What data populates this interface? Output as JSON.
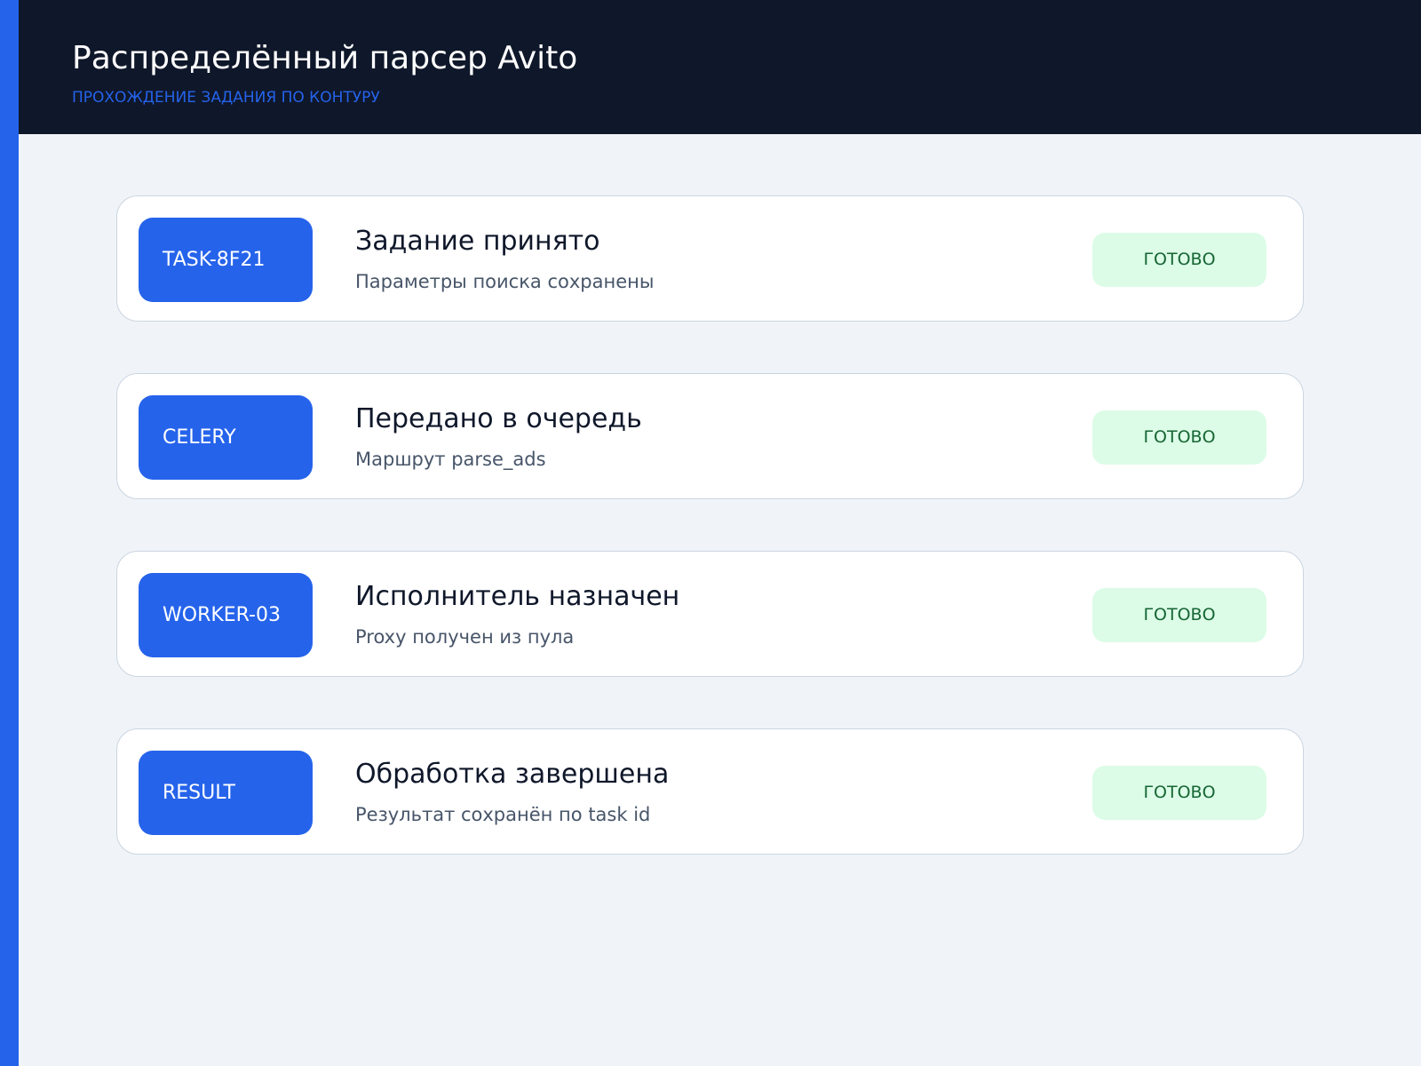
{
  "header": {
    "title": "Распределённый парсер Avito",
    "subtitle": "ПРОХОЖДЕНИЕ ЗАДАНИЯ ПО КОНТУРУ"
  },
  "steps": [
    {
      "tag": "TASK-8F21",
      "title": "Задание принято",
      "description": "Параметры поиска сохранены",
      "status": "ГОТОВО"
    },
    {
      "tag": "CELERY",
      "title": "Передано в очередь",
      "description": "Маршрут parse_ads",
      "status": "ГОТОВО"
    },
    {
      "tag": "WORKER-03",
      "title": "Исполнитель назначен",
      "description": "Proxy получен из пула",
      "status": "ГОТОВО"
    },
    {
      "tag": "RESULT",
      "title": "Обработка завершена",
      "description": "Результат сохранён по task id",
      "status": "ГОТОВО"
    }
  ],
  "colors": {
    "accent": "#2563eb",
    "header_background": "#0f172a",
    "page_background": "#f0f4f8",
    "status_background": "#dcfce7",
    "status_text": "#166534"
  }
}
